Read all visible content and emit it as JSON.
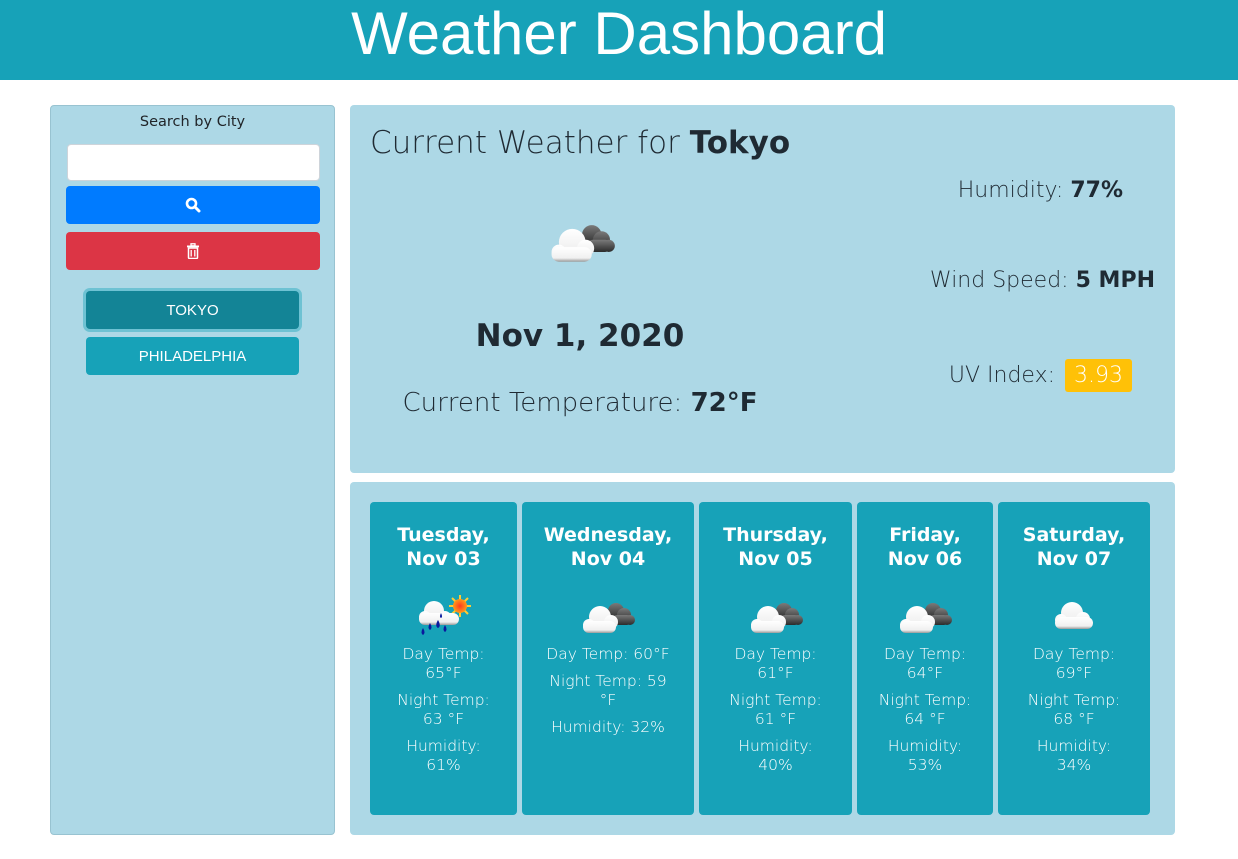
{
  "header": {
    "title": "Weather Dashboard",
    "color": "#17a2b8"
  },
  "sidebar": {
    "search_label": "Search by City",
    "search_input": {
      "value": "",
      "placeholder": ""
    },
    "search_button_icon": "search-icon",
    "clear_button_icon": "trash-icon",
    "cities": [
      {
        "label": "TOKYO",
        "active": true
      },
      {
        "label": "PHILADELPHIA",
        "active": false
      }
    ]
  },
  "current": {
    "title_prefix": "Current Weather for",
    "city": "Tokyo",
    "icon": "partly-cloudy-icon",
    "date": "Nov 1, 2020",
    "temperature_label": "Current Temperature:",
    "temperature_value": "72°F",
    "humidity_label": "Humidity:",
    "humidity_value": "77%",
    "wind_label": "Wind Speed:",
    "wind_value": "5 MPH",
    "uv_label": "UV Index:",
    "uv_value": "3.93",
    "uv_color": "#ffc107"
  },
  "forecast": [
    {
      "day": "Tuesday,",
      "date": "Nov 03",
      "icon": "rain-sun-cloud-icon",
      "day_temp": "Day Temp: 65°F",
      "night_temp": "Night Temp: 63 °F",
      "humidity": "Humidity: 61%"
    },
    {
      "day": "Wednesday,",
      "date": "Nov 04",
      "icon": "broken-clouds-icon",
      "day_temp": "Day Temp: 60°F",
      "night_temp": "Night Temp: 59 °F",
      "humidity": "Humidity: 32%"
    },
    {
      "day": "Thursday,",
      "date": "Nov 05",
      "icon": "broken-clouds-icon",
      "day_temp": "Day Temp: 61°F",
      "night_temp": "Night Temp: 61 °F",
      "humidity": "Humidity: 40%"
    },
    {
      "day": "Friday,",
      "date": "Nov 06",
      "icon": "broken-clouds-icon",
      "day_temp": "Day Temp: 64°F",
      "night_temp": "Night Temp: 64 °F",
      "humidity": "Humidity: 53%"
    },
    {
      "day": "Saturday,",
      "date": "Nov 07",
      "icon": "cloud-icon",
      "day_temp": "Day Temp: 69°F",
      "night_temp": "Night Temp: 68 °F",
      "humidity": "Humidity: 34%"
    }
  ]
}
